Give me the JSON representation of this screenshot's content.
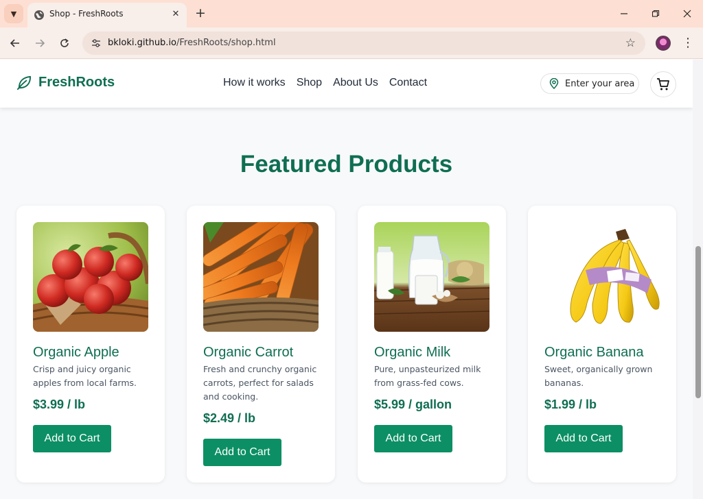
{
  "browser": {
    "tab_title": "Shop - FreshRoots",
    "url_domain": "bkloki.github.io",
    "url_path": "/FreshRoots/shop.html"
  },
  "site": {
    "logo_text": "FreshRoots",
    "nav": [
      "How it works",
      "Shop",
      "About Us",
      "Contact"
    ],
    "area_placeholder": "Enter your area",
    "accent_color": "#0f6e52",
    "button_color": "#0c8f64"
  },
  "section_title": "Featured Products",
  "products": [
    {
      "name": "Organic Apple",
      "description": "Crisp and juicy organic apples from local farms.",
      "price": "$3.99 / lb",
      "button": "Add to Cart",
      "image": "apple-basket-image"
    },
    {
      "name": "Organic Carrot",
      "description": "Fresh and crunchy organic carrots, perfect for salads and cooking.",
      "price": "$2.49 / lb",
      "button": "Add to Cart",
      "image": "carrot-basket-image"
    },
    {
      "name": "Organic Milk",
      "description": "Pure, unpasteurized milk from grass-fed cows.",
      "price": "$5.99 / gallon",
      "button": "Add to Cart",
      "image": "milk-jug-image"
    },
    {
      "name": "Organic Banana",
      "description": "Sweet, organically grown bananas.",
      "price": "$1.99 / lb",
      "button": "Add to Cart",
      "image": "banana-bunch-image"
    }
  ]
}
